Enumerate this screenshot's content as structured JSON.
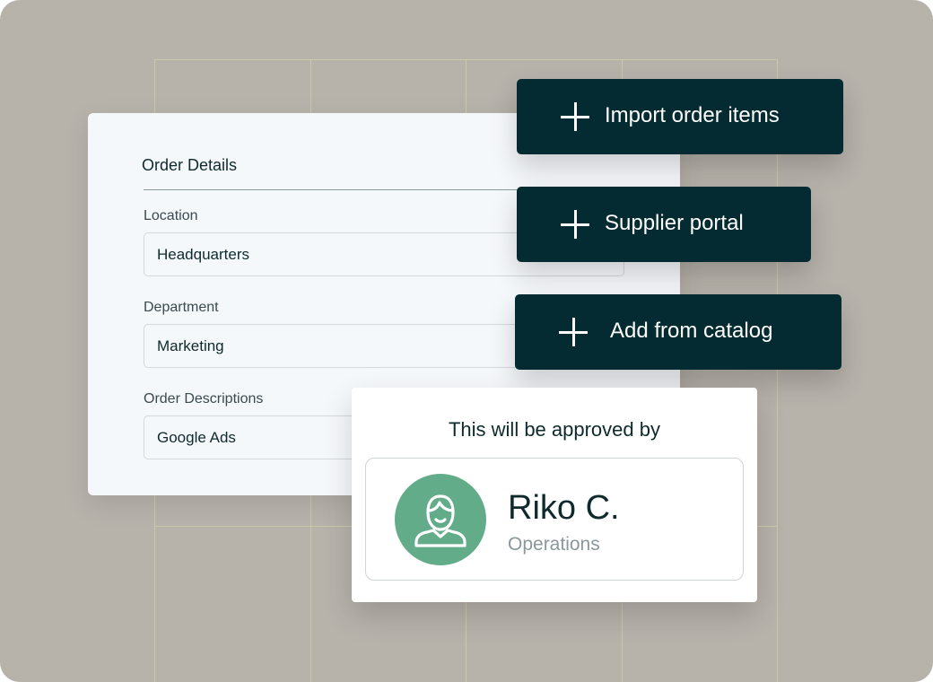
{
  "order_details": {
    "title": "Order Details",
    "fields": [
      {
        "label": "Location",
        "value": "Headquarters"
      },
      {
        "label": "Department",
        "value": "Marketing"
      },
      {
        "label": "Order Descriptions",
        "value": "Google Ads"
      }
    ]
  },
  "actions": [
    {
      "label": "Import order items",
      "icon": "plus-icon"
    },
    {
      "label": "Supplier portal",
      "icon": "plus-icon"
    },
    {
      "label": "Add from catalog",
      "icon": "plus-icon"
    }
  ],
  "approval": {
    "title": "This will be approved by",
    "approver": {
      "name": "Riko C.",
      "department": "Operations",
      "avatar_icon": "user-avatar-icon",
      "avatar_color": "#62ac8a"
    }
  },
  "colors": {
    "background": "#b7b2aa",
    "button": "#032b31",
    "card": "#f5f8fb"
  }
}
